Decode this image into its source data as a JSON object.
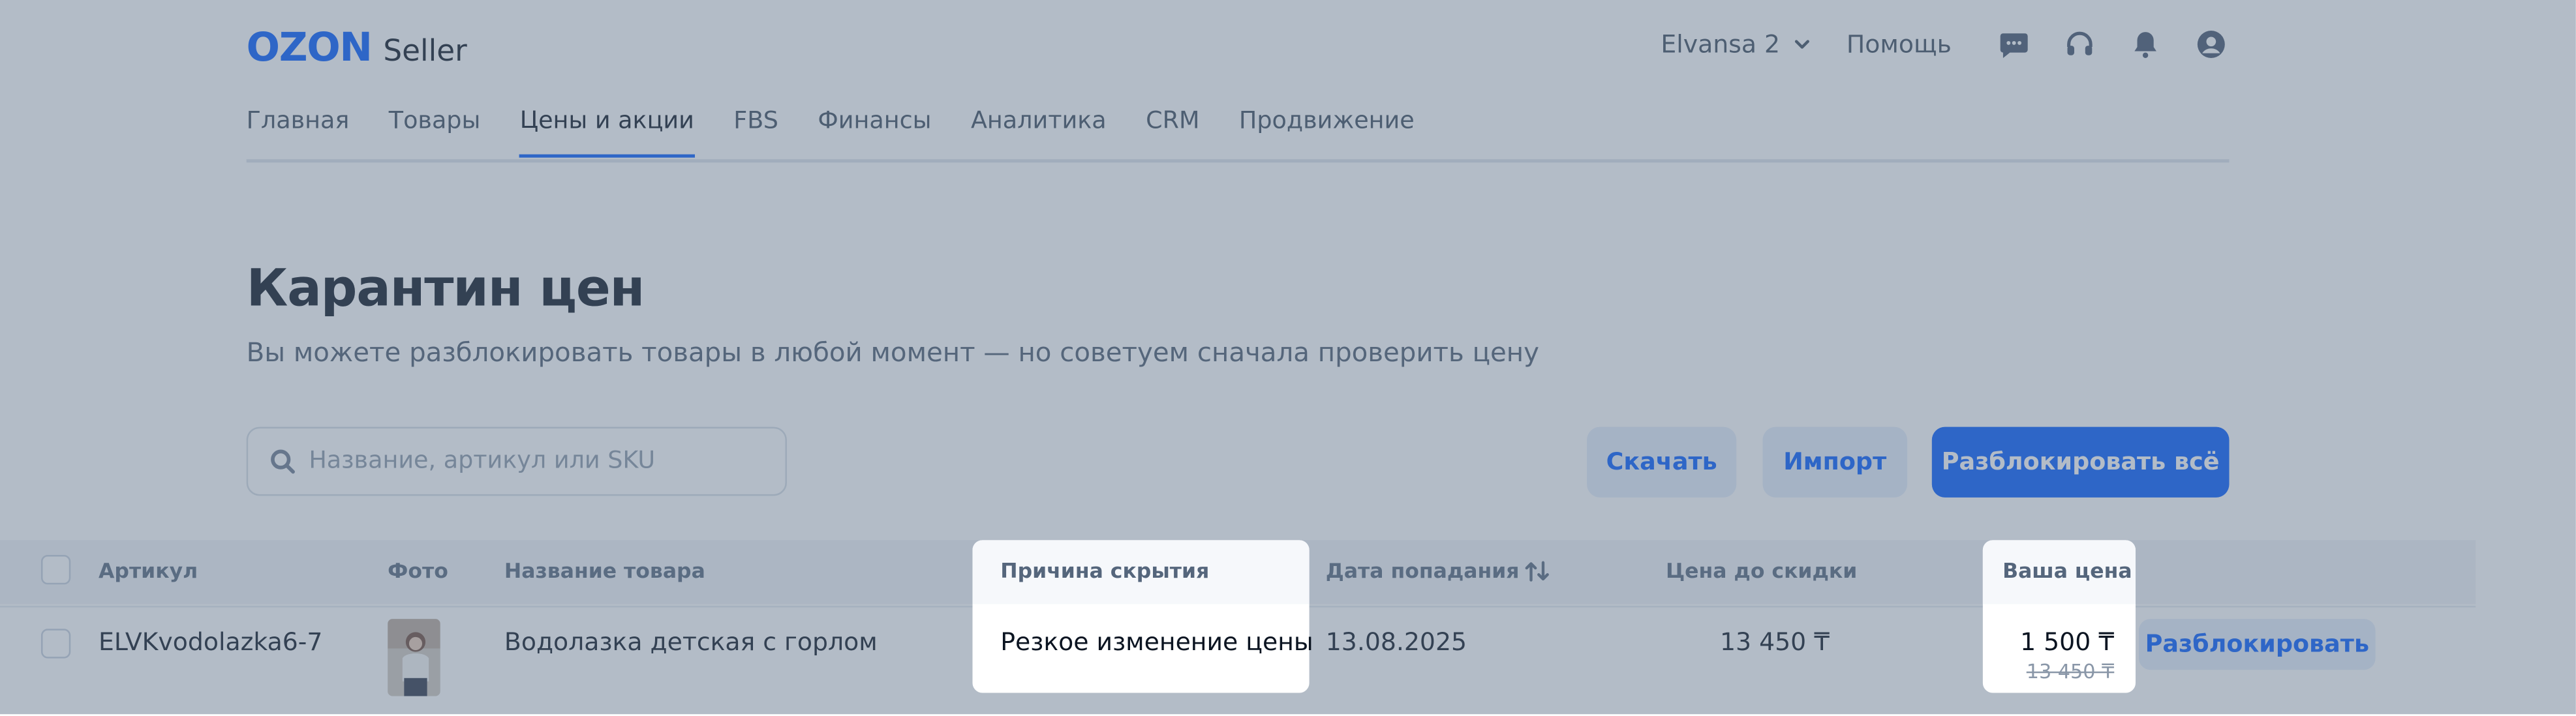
{
  "header": {
    "logo_mark": "OZON",
    "logo_text": "Seller",
    "account": "Elvansa 2",
    "help": "Помощь",
    "icons": [
      "chat-icon",
      "headset-icon",
      "bell-icon",
      "profile-icon"
    ]
  },
  "nav": {
    "items": [
      {
        "label": "Главная"
      },
      {
        "label": "Товары"
      },
      {
        "label": "Цены и акции",
        "active": true
      },
      {
        "label": "FBS"
      },
      {
        "label": "Финансы"
      },
      {
        "label": "Аналитика"
      },
      {
        "label": "CRM"
      },
      {
        "label": "Продвижение"
      }
    ]
  },
  "page": {
    "title": "Карантин цен",
    "subtitle": "Вы можете разблокировать товары в любой момент — но советуем сначала проверить цену"
  },
  "search": {
    "placeholder": "Название, артикул или SKU"
  },
  "actions": {
    "download": "Скачать",
    "import": "Импорт",
    "unblock_all": "Разблокировать всё"
  },
  "table": {
    "columns": {
      "sku": "Артикул",
      "photo": "Фото",
      "name": "Название товара",
      "reason": "Причина скрытия",
      "date": "Дата попадания",
      "price_before": "Цена до скидки",
      "your_price": "Ваша цена"
    },
    "rows": [
      {
        "sku": "ELVKvodolazka6-7",
        "name": "Водолазка детская с горлом",
        "reason": "Резкое изменение цены",
        "date": "13.08.2025",
        "price_before": "13 450 ₸",
        "your_price": "1 500 ₸",
        "old_price": "13 450 ₸",
        "unblock": "Разблокировать"
      }
    ]
  },
  "colors": {
    "brand": "#005bff",
    "overlay": "rgba(97,115,137,0.48)"
  }
}
